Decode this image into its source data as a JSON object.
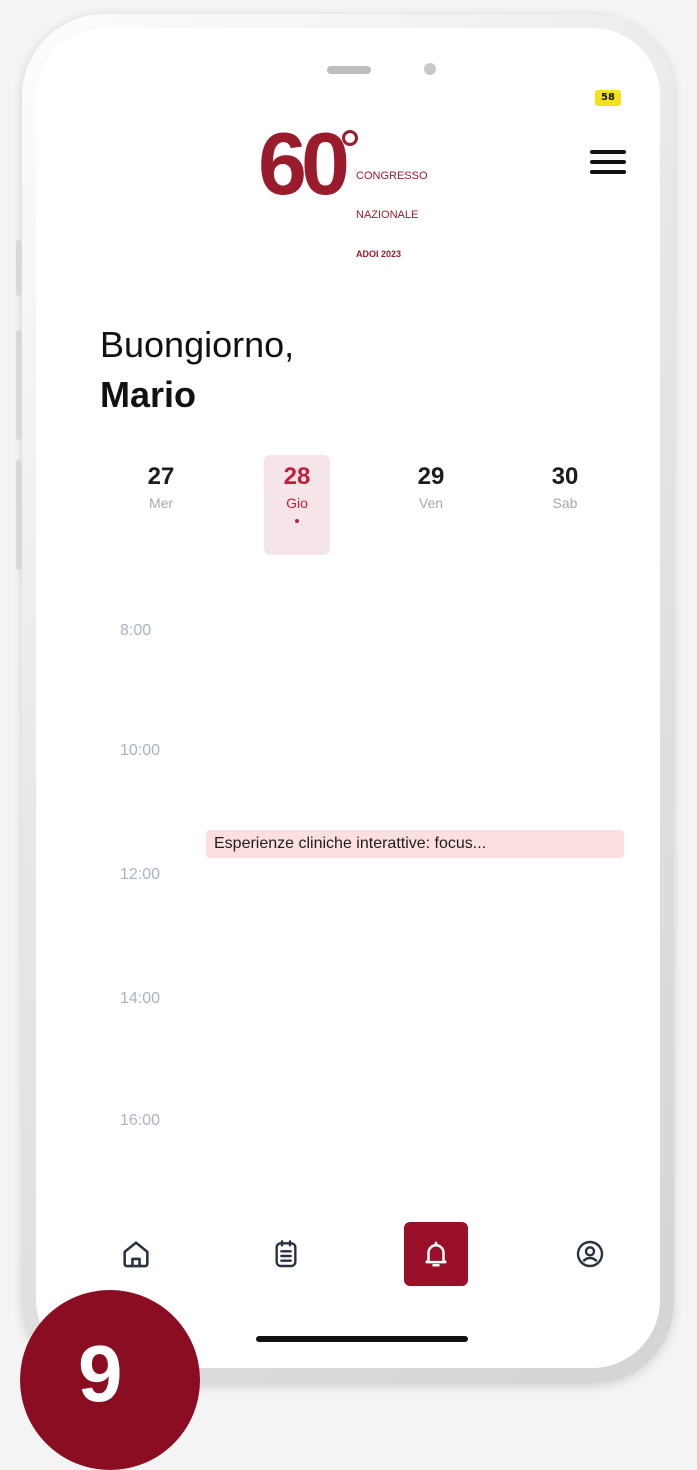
{
  "status": {
    "badge": "58"
  },
  "logo": {
    "number": "60",
    "line1": "CONGRESSO",
    "line2": "NAZIONALE",
    "line3": "ADOI 2023"
  },
  "greeting": {
    "line1": "Buongiorno,",
    "name": "Mario"
  },
  "days": [
    {
      "num": "27",
      "weekday": "Mer",
      "active": false
    },
    {
      "num": "28",
      "weekday": "Gio",
      "active": true
    },
    {
      "num": "29",
      "weekday": "Ven",
      "active": false
    },
    {
      "num": "30",
      "weekday": "Sab",
      "active": false
    }
  ],
  "timeline": {
    "hours": [
      "8:00",
      "10:00",
      "12:00",
      "14:00",
      "16:00"
    ],
    "event": {
      "title": "Esperienze cliniche interattive: focus..."
    }
  },
  "bottom_nav": {
    "items": [
      {
        "icon": "home-icon",
        "active": false
      },
      {
        "icon": "agenda-icon",
        "active": false
      },
      {
        "icon": "bell-icon",
        "active": true
      },
      {
        "icon": "profile-icon",
        "active": false
      }
    ]
  },
  "corner_badge": {
    "label": "9"
  },
  "colors": {
    "brand": "#9a1b2c",
    "accent": "#c51e3a",
    "event_bg": "#fbe0df"
  }
}
